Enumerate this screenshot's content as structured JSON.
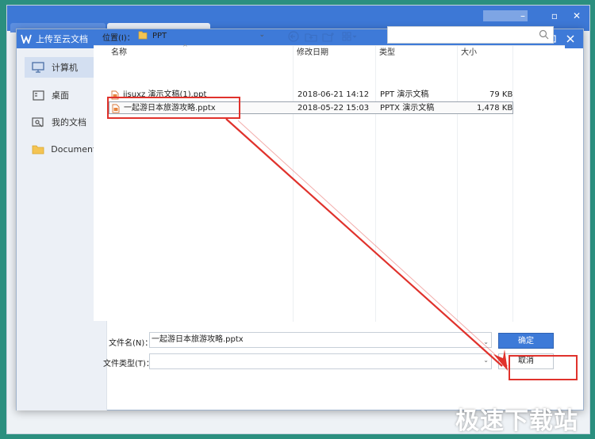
{
  "dialog": {
    "title": "上传至云文档",
    "accent_color": "#3e7ad8"
  },
  "sidebar": {
    "items": [
      {
        "label": "计算机",
        "icon": "monitor-icon",
        "active": true
      },
      {
        "label": "桌面",
        "icon": "desktop-icon",
        "active": false
      },
      {
        "label": "我的文档",
        "icon": "my-documents-icon",
        "active": false
      },
      {
        "label": "Documents",
        "icon": "folder-icon",
        "active": false
      }
    ]
  },
  "toolbar": {
    "location_label": "位置(I)：",
    "location_value": "PPT",
    "buttons": [
      "back-icon",
      "up-folder-icon",
      "new-folder-icon",
      "view-menu-icon"
    ]
  },
  "search": {
    "placeholder": ""
  },
  "filelist": {
    "columns": [
      "名称",
      "修改日期",
      "类型",
      "大小"
    ],
    "rows": [
      {
        "name": "jisuxz 演示文稿(1).ppt",
        "date": "2018-06-21 14:12",
        "type": "PPT 演示文稿",
        "size": "79 KB",
        "selected": false
      },
      {
        "name": "一起游日本旅游攻略.pptx",
        "date": "2018-05-22 15:03",
        "type": "PPTX 演示文稿",
        "size": "1,478 KB",
        "selected": true
      }
    ]
  },
  "bottom": {
    "filename_label": "文件名(N)：",
    "filename_value": "一起游日本旅游攻略.pptx",
    "filetype_label": "文件类型(T)：",
    "filetype_value": "",
    "ok_label": "确定",
    "cancel_label": "取消"
  },
  "watermark": "极速下载站",
  "annotation_color": "#e0322c"
}
